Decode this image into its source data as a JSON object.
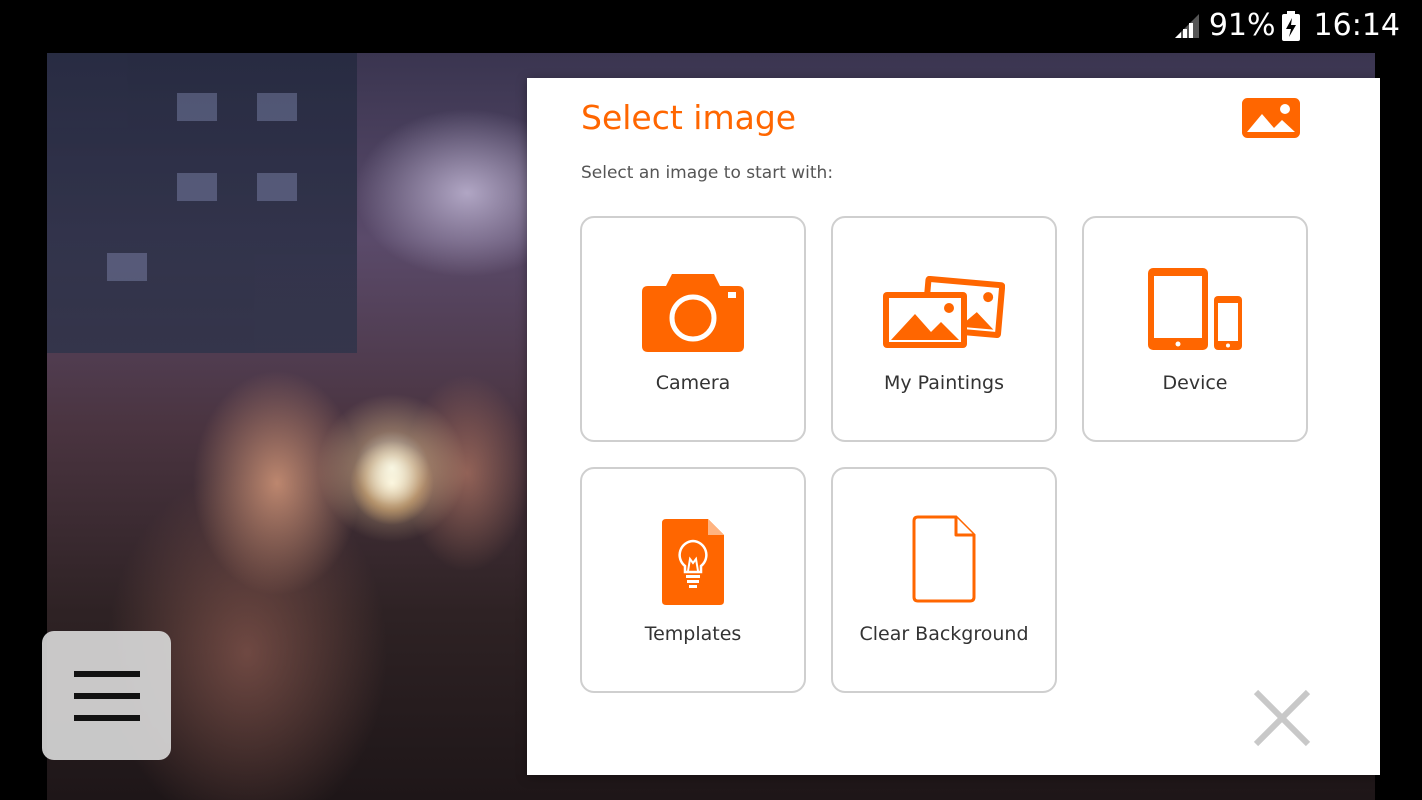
{
  "status_bar": {
    "battery_percent": "91%",
    "time": "16:14",
    "icons": [
      "signal-icon",
      "battery-charging-icon"
    ]
  },
  "dialog": {
    "title": "Select image",
    "subtitle": "Select an image to start with:",
    "title_icon": "image-icon",
    "tiles": [
      {
        "label": "Camera",
        "icon": "camera-icon"
      },
      {
        "label": "My Paintings",
        "icon": "gallery-icon"
      },
      {
        "label": "Device",
        "icon": "tablet-phone-icon"
      },
      {
        "label": "Templates",
        "icon": "lightbulb-document-icon"
      },
      {
        "label": "Clear Background",
        "icon": "blank-document-icon"
      }
    ],
    "close_icon": "close-icon"
  },
  "menu_button": {
    "icon": "hamburger-menu-icon"
  },
  "colors": {
    "accent": "#ff6600",
    "tile_border": "#cfcfcf",
    "close": "#c8c8c8",
    "menu_bg": "#d7d7d7"
  }
}
